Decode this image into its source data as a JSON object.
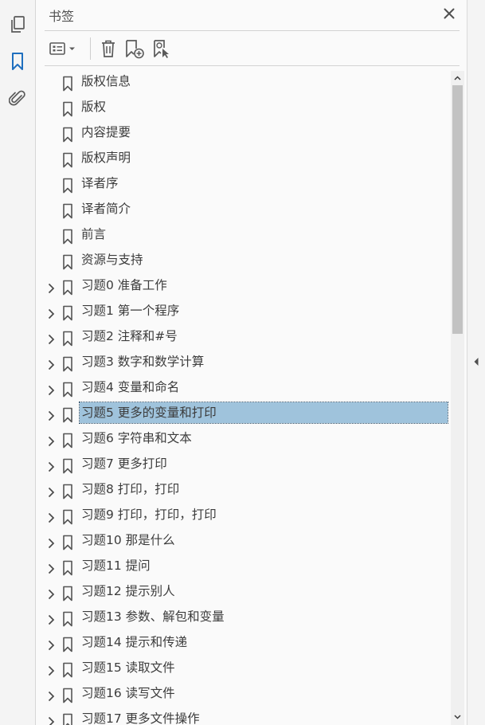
{
  "panel": {
    "title": "书签"
  },
  "icons": {
    "rail": [
      "pages-icon",
      "bookmark-icon",
      "attachment-icon"
    ],
    "toolbar": [
      "options-menu-icon",
      "delete-icon",
      "new-bookmark-icon",
      "bookmark-from-selection-icon"
    ],
    "close": "close-icon"
  },
  "colors": {
    "accent": "#1f6fbf",
    "selection": "#9fc3dc",
    "icon": "#5a5a5a"
  },
  "bookmarks": [
    {
      "label": "版权信息",
      "expandable": false
    },
    {
      "label": "版权",
      "expandable": false
    },
    {
      "label": "内容提要",
      "expandable": false
    },
    {
      "label": "版权声明",
      "expandable": false
    },
    {
      "label": "译者序",
      "expandable": false
    },
    {
      "label": "译者简介",
      "expandable": false
    },
    {
      "label": "前言",
      "expandable": false
    },
    {
      "label": "资源与支持",
      "expandable": false
    },
    {
      "label": "习题0 准备工作",
      "expandable": true
    },
    {
      "label": "习题1 第一个程序",
      "expandable": true
    },
    {
      "label": "习题2 注释和#号",
      "expandable": true
    },
    {
      "label": "习题3 数字和数学计算",
      "expandable": true
    },
    {
      "label": "习题4 变量和命名",
      "expandable": true
    },
    {
      "label": "习题5 更多的变量和打印",
      "expandable": true,
      "selected": true
    },
    {
      "label": "习题6 字符串和文本",
      "expandable": true
    },
    {
      "label": "习题7 更多打印",
      "expandable": true
    },
    {
      "label": "习题8 打印，打印",
      "expandable": true
    },
    {
      "label": "习题9 打印，打印，打印",
      "expandable": true
    },
    {
      "label": "习题10 那是什么",
      "expandable": true
    },
    {
      "label": "习题11 提问",
      "expandable": true
    },
    {
      "label": "习题12 提示别人",
      "expandable": true
    },
    {
      "label": "习题13 参数、解包和变量",
      "expandable": true
    },
    {
      "label": "习题14 提示和传递",
      "expandable": true
    },
    {
      "label": "习题15 读取文件",
      "expandable": true
    },
    {
      "label": "习题16 读写文件",
      "expandable": true
    },
    {
      "label": "习题17 更多文件操作",
      "expandable": true
    }
  ]
}
